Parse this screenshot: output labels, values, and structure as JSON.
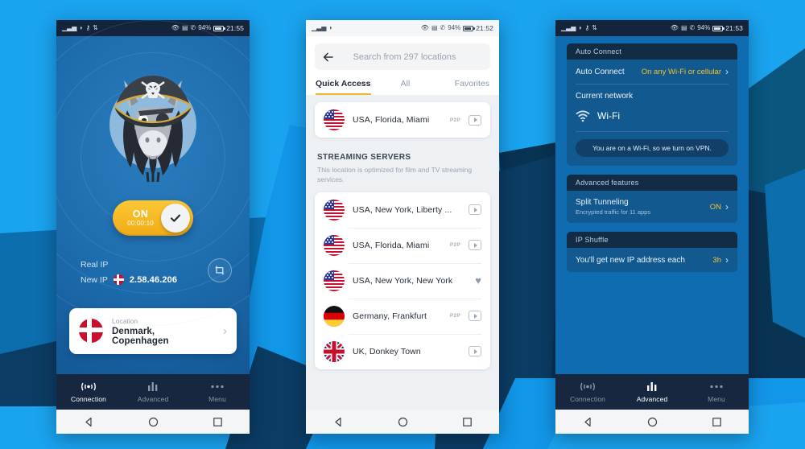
{
  "background": {
    "colors": [
      "#1aa3ee",
      "#1296e8",
      "#0d6eae",
      "#0b3c63",
      "#093352",
      "#0a567f"
    ]
  },
  "phones": {
    "left": {
      "statusbar": {
        "left_icons": [
          "signal-icon",
          "wifi-icon",
          "key-icon",
          "sync-icon"
        ],
        "right_icons": [
          "eye-icon",
          "vibrate-icon",
          "phone-icon"
        ],
        "battery": "94%",
        "time": "21:55"
      },
      "mascot": "pirate-donkey-mascot",
      "toggle": {
        "state": "ON",
        "timer": "00:00:10",
        "check": "check-icon"
      },
      "ip": {
        "real_label": "Real IP",
        "real_value": "",
        "new_label": "New IP",
        "new_value": "2.58.46.206",
        "flag": "denmark-flag",
        "shuffle_icon": "shuffle-icon"
      },
      "location_card": {
        "label": "Location",
        "name": "Denmark, Copenhagen",
        "flag": "denmark-flag",
        "chevron": "›"
      },
      "tabs": [
        {
          "label": "Connection",
          "icon": "connection-icon",
          "active": true
        },
        {
          "label": "Advanced",
          "icon": "bars-icon",
          "active": false
        },
        {
          "label": "Menu",
          "icon": "dots-icon",
          "active": false
        }
      ]
    },
    "center": {
      "statusbar": {
        "left_icons": [
          "signal-icon",
          "wifi-icon"
        ],
        "battery": "94%",
        "time": "21:52"
      },
      "search": {
        "back_icon": "back-arrow-icon",
        "placeholder": "Search from 297 locations",
        "value": ""
      },
      "tabs": [
        {
          "label": "Quick Access",
          "active": true
        },
        {
          "label": "All",
          "active": false
        },
        {
          "label": "Favorites",
          "active": false
        }
      ],
      "quick_access": [
        {
          "flag": "usa-flag",
          "name": "USA, Florida, Miami",
          "badge": "P2P",
          "action": "play"
        }
      ],
      "section": {
        "title": "STREAMING SERVERS",
        "subtitle": "This location is optimized for film and TV streaming services."
      },
      "streaming": [
        {
          "flag": "usa-flag",
          "name": "USA, New York, Liberty ...",
          "badge": "",
          "action": "play"
        },
        {
          "flag": "usa-flag",
          "name": "USA, Florida, Miami",
          "badge": "P2P",
          "action": "play"
        },
        {
          "flag": "usa-flag",
          "name": "USA, New York, New York",
          "badge": "",
          "action": "heart"
        },
        {
          "flag": "germany-flag",
          "name": "Germany, Frankfurt",
          "badge": "P2P",
          "action": "play"
        },
        {
          "flag": "uk-flag",
          "name": "UK, Donkey Town",
          "badge": "",
          "action": "play"
        }
      ]
    },
    "right": {
      "statusbar": {
        "left_icons": [
          "signal-icon",
          "wifi-icon",
          "key-icon",
          "sync-icon"
        ],
        "battery": "94%",
        "time": "21:53"
      },
      "auto_connect": {
        "header": "Auto Connect",
        "row_label": "Auto Connect",
        "row_value": "On any Wi-Fi or cellular",
        "network_label": "Current network",
        "network_name": "Wi-Fi",
        "network_icon": "wifi-icon",
        "notice": "You are on a Wi-Fi, so we turn on VPN."
      },
      "advanced": {
        "header": "Advanced features",
        "row_label": "Split Tunneling",
        "row_sub": "Encrypted traffic for 11 apps",
        "row_value": "ON"
      },
      "ip_shuffle": {
        "header": "IP Shuffle",
        "row_label": "You'll get new IP address each",
        "row_value": "3h"
      },
      "tabs": [
        {
          "label": "Connection",
          "icon": "connection-icon",
          "active": false
        },
        {
          "label": "Advanced",
          "icon": "bars-icon",
          "active": true
        },
        {
          "label": "Menu",
          "icon": "dots-icon",
          "active": false
        }
      ]
    }
  },
  "nav": {
    "back": "back-triangle-icon",
    "home": "home-circle-icon",
    "recents": "recents-square-icon"
  }
}
